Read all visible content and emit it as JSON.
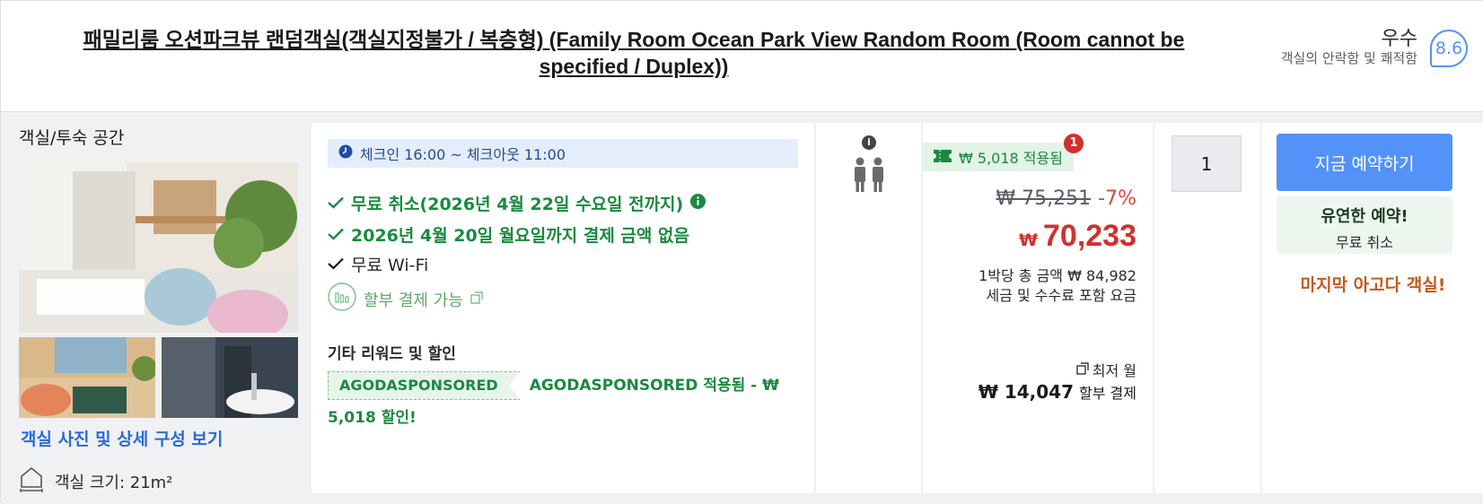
{
  "header": {
    "room_title": "패밀리룸 오션파크뷰 랜덤객실(객실지정불가 / 복층형) (Family Room Ocean Park View Random Room (Room cannot be specified / Duplex))",
    "rating_label": "우수",
    "rating_sub": "객실의 안락함 및 쾌적함",
    "score": "8.6"
  },
  "left": {
    "title": "객실/투숙 공간",
    "photos_link": "객실 사진 및 상세 구성 보기",
    "room_size": "객실 크기: 21m²"
  },
  "benefits": {
    "checkin": "체크인 16:00 ~ 체크아웃 11:00",
    "free_cancel": "무료 취소(2026년 4월 22일 수요일 전까지)",
    "no_payment": "2026년 4월 20일 월요일까지 결제 금액 없음",
    "wifi": "무료 Wi-Fi",
    "installment": "할부 결제 가능",
    "rewards_title": "기타 리워드 및 할인",
    "coupon_code": "AGODASPONSORED",
    "coupon_text": "AGODASPONSORED 적용됨 - ₩ 5,018 할인!"
  },
  "guests": {
    "info_icon": "i"
  },
  "price": {
    "applied": "₩ 5,018 적용됨",
    "badge_count": "1",
    "original": "₩ 75,251",
    "discount_pct": "-7%",
    "currency": "₩",
    "final": "70,233",
    "per_night": "1박당 총 금액 ₩ 84,982",
    "tax_note": "세금 및 수수료 포함 요금",
    "monthly_label": "최저 월",
    "installment_amount": "₩ 14,047",
    "installment_label": "할부 결제"
  },
  "quantity": {
    "value": "1"
  },
  "booking": {
    "book_now": "지금 예약하기",
    "flexible_title": "유연한 예약!",
    "flexible_sub": "무료 취소",
    "last_room": "마지막 아고다 객실!"
  },
  "colors": {
    "accent_blue": "#5392f9",
    "green": "#1a8a3f",
    "red": "#d0312d",
    "orange": "#c4591a"
  }
}
